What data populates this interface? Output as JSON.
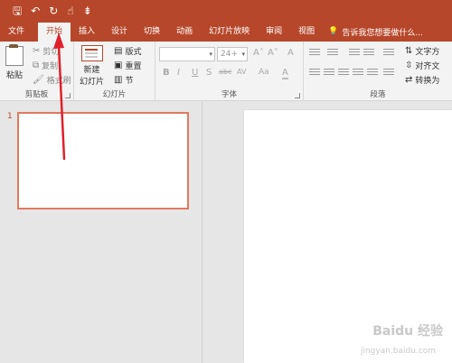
{
  "qat": {
    "save": "🖫",
    "undo": "↶",
    "redo": "↻",
    "touch": "☝",
    "more": "⇟"
  },
  "tabs": [
    "文件",
    "开始",
    "插入",
    "设计",
    "切换",
    "动画",
    "幻灯片放映",
    "审阅",
    "视图"
  ],
  "tellme": "告诉我您想要做什么...",
  "clipboard": {
    "paste": "粘贴",
    "cut": "剪切",
    "copy": "复制",
    "format_painter": "格式刷",
    "label": "剪贴板"
  },
  "slides": {
    "new_slide_1": "新建",
    "new_slide_2": "幻灯片",
    "layout": "版式",
    "reset": "重置",
    "section": "节",
    "label": "幻灯片"
  },
  "font": {
    "font_name": "",
    "font_size": "24+",
    "grow": "A˄",
    "shrink": "A˅",
    "clear": "A",
    "bold": "B",
    "italic": "I",
    "underline": "U",
    "shadow": "S",
    "strike": "abc",
    "spacing": "AV",
    "case": "Aa",
    "color": "A",
    "label": "字体"
  },
  "paragraph": {
    "text_direction": "文字方",
    "align_text": "对齐文",
    "convert": "转换为",
    "label": "段落"
  },
  "slide_number": "1",
  "watermark": {
    "brand": "Baidu 经验",
    "url": "jingyan.baidu.com"
  },
  "colors": {
    "accent": "#b7472a",
    "arrow": "#e0202a"
  }
}
